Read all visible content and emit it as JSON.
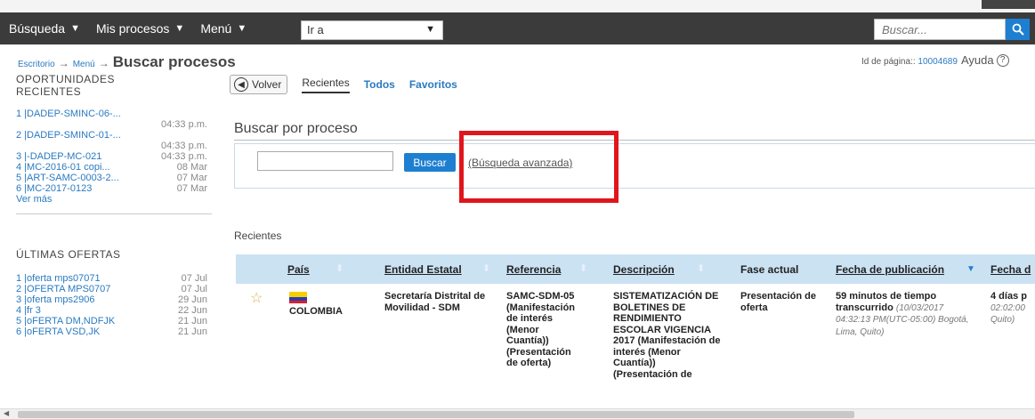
{
  "navbar": {
    "items": [
      {
        "label": "Búsqueda",
        "icon": "caret-down-icon"
      },
      {
        "label": "Mis procesos",
        "icon": "caret-down-icon"
      },
      {
        "label": "Menú",
        "icon": "caret-down-icon"
      }
    ],
    "goto_value": "Ir a",
    "search_placeholder": "Buscar...",
    "search_icon": "search-icon"
  },
  "breadcrumb": {
    "items": [
      "Escritorio",
      "Menú"
    ],
    "separator": "→",
    "title": "Buscar procesos"
  },
  "page_meta": {
    "id_label": "Id de página::",
    "id_value": "10004689",
    "help_label": "Ayuda",
    "help_icon": "?"
  },
  "sidebar": {
    "opportunities_heading": "OPORTUNIDADES RECIENTES",
    "opportunities": [
      {
        "label": "1 |DADEP-SMINC-06-...",
        "date": "04:33 p.m."
      },
      {
        "label": "2 |DADEP-SMINC-01-...",
        "date": "04:33 p.m."
      },
      {
        "label": "3 |-DADEP-MC-021",
        "date": "04:33 p.m."
      },
      {
        "label": "4 |MC-2016-01 copi...",
        "date": "08 Mar"
      },
      {
        "label": "5 |ART-SAMC-0003-2...",
        "date": "07 Mar"
      },
      {
        "label": "6 |MC-2017-0123",
        "date": "07 Mar"
      }
    ],
    "more_label": "Ver más",
    "offers_heading": "ÚLTIMAS OFERTAS",
    "offers": [
      {
        "label": "1 |oferta mps07071",
        "date": "07 Jul"
      },
      {
        "label": "2 |OFERTA MPS0707",
        "date": "07 Jul"
      },
      {
        "label": "3 |oferta mps2906",
        "date": "29 Jun"
      },
      {
        "label": "4 |fr 3",
        "date": "22 Jun"
      },
      {
        "label": "5 |oFERTA DM,NDFJK",
        "date": "21 Jun"
      },
      {
        "label": "6 |oFERTA VSD,JK",
        "date": "21 Jun"
      }
    ]
  },
  "main": {
    "back_label": "Volver",
    "tabs": [
      {
        "label": "Recientes",
        "active": true
      },
      {
        "label": "Todos",
        "active": false
      },
      {
        "label": "Favoritos",
        "active": false
      }
    ],
    "section_title": "Buscar por proceso",
    "search_button": "Buscar",
    "advanced_link": "(Búsqueda avanzada)",
    "recent_label": "Recientes"
  },
  "table": {
    "columns": [
      "País",
      "Entidad Estatal",
      "Referencia",
      "Descripción",
      "Fase actual",
      "Fecha de publicación",
      "Fecha d"
    ],
    "rows": [
      {
        "country": "COLOMBIA",
        "entity": "Secretaría Distrital de Movilidad - SDM",
        "reference": "SAMC-SDM-05 (Manifestación de interés (Menor Cuantía)) (Presentación de oferta)",
        "description": "SISTEMATIZACIÓN DE BOLETINES DE RENDIMIENTO ESCOLAR VIGENCIA 2017 (Manifestación de interés (Menor Cuantía)) (Presentación de",
        "phase": "Presentación de oferta",
        "published_main": "59 minutos de tiempo transcurrido",
        "published_detail": "(10/03/2017 04:32:13 PM(UTC-05:00) Bogotá, Lima, Quito)",
        "next_main": "4 días p",
        "next_detail": "02:02:00 Quito)"
      }
    ]
  },
  "colors": {
    "navbar_bg": "#3b3b3b",
    "accent": "#1e7fd1",
    "link": "#2a7ac0",
    "table_header": "#cbe2f3",
    "highlight": "#e0161c"
  }
}
